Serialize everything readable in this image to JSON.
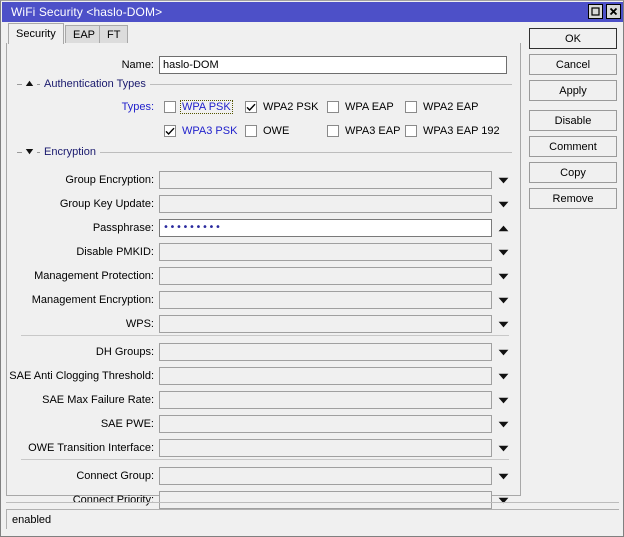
{
  "window": {
    "title": "WiFi Security <haslo-DOM>",
    "controls": [
      {
        "name": "maximize-button",
        "icon": "maximize-icon"
      },
      {
        "name": "close-button",
        "icon": "close-icon"
      }
    ]
  },
  "tabs": [
    {
      "label": "Security",
      "active": true
    },
    {
      "label": "EAP",
      "active": false
    },
    {
      "label": "FT",
      "active": false
    }
  ],
  "form": {
    "name_label": "Name:",
    "name_value": "haslo-DOM",
    "groups": {
      "auth": {
        "title": "Authentication Types",
        "state": "expanded",
        "icon": "chevron-up-icon"
      },
      "encryption": {
        "title": "Encryption",
        "state": "collapsed",
        "icon": "chevron-down-icon"
      }
    },
    "types_label": "Types:",
    "auth_types": [
      {
        "label": "WPA PSK",
        "checked": false,
        "blue": true,
        "focused": true
      },
      {
        "label": "WPA2 PSK",
        "checked": true,
        "blue": false,
        "focused": false
      },
      {
        "label": "WPA EAP",
        "checked": false,
        "blue": false,
        "focused": false
      },
      {
        "label": "WPA2 EAP",
        "checked": false,
        "blue": false,
        "focused": false
      },
      {
        "label": "WPA3 PSK",
        "checked": true,
        "blue": true,
        "focused": false
      },
      {
        "label": "OWE",
        "checked": false,
        "blue": false,
        "focused": false
      },
      {
        "label": "WPA3 EAP",
        "checked": false,
        "blue": false,
        "focused": false
      },
      {
        "label": "WPA3 EAP 192",
        "checked": false,
        "blue": false,
        "focused": false
      }
    ],
    "fields": [
      {
        "label": "Group Encryption:",
        "value": "",
        "arrow": "chevron-down-icon",
        "active": false
      },
      {
        "label": "Group Key Update:",
        "value": "",
        "arrow": "chevron-down-icon",
        "active": false
      },
      {
        "label": "Passphrase:",
        "value": "•••••••••",
        "masked": true,
        "arrow": "chevron-up-icon",
        "active": true
      },
      {
        "label": "Disable PMKID:",
        "value": "",
        "arrow": "chevron-down-icon",
        "active": false
      },
      {
        "label": "Management Protection:",
        "value": "",
        "arrow": "chevron-down-icon",
        "active": false
      },
      {
        "label": "Management Encryption:",
        "value": "",
        "arrow": "chevron-down-icon",
        "active": false
      },
      {
        "label": "WPS:",
        "value": "",
        "arrow": "chevron-down-icon",
        "active": false
      },
      {
        "label": "DH Groups:",
        "value": "",
        "arrow": "chevron-down-icon",
        "active": false
      },
      {
        "label": "SAE Anti Clogging Threshold:",
        "value": "",
        "arrow": "chevron-down-icon",
        "active": false
      },
      {
        "label": "SAE Max Failure Rate:",
        "value": "",
        "arrow": "chevron-down-icon",
        "active": false
      },
      {
        "label": "SAE PWE:",
        "value": "",
        "arrow": "chevron-down-icon",
        "active": false
      },
      {
        "label": "OWE Transition Interface:",
        "value": "",
        "arrow": "chevron-down-icon",
        "active": false
      },
      {
        "label": "Connect Group:",
        "value": "",
        "arrow": "chevron-down-icon",
        "active": false
      },
      {
        "label": "Connect Priority:",
        "value": "",
        "arrow": "chevron-down-icon",
        "active": false
      }
    ]
  },
  "buttons": [
    {
      "label": "OK",
      "default": true
    },
    {
      "label": "Cancel",
      "default": false
    },
    {
      "label": "Apply",
      "default": false
    },
    {
      "label": "Disable",
      "default": false,
      "gap": true
    },
    {
      "label": "Comment",
      "default": false
    },
    {
      "label": "Copy",
      "default": false
    },
    {
      "label": "Remove",
      "default": false
    }
  ],
  "status": {
    "text": "enabled"
  },
  "colors": {
    "titlebar": "#4d50c8",
    "window_bg": "#f0f0f0",
    "accent_text": "#2222cc",
    "group_title": "#1a1a6e"
  }
}
